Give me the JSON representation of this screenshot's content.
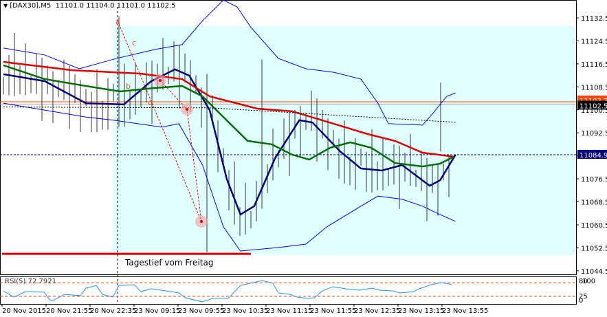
{
  "header": {
    "symbol": "[DAX30],M5",
    "ohlc": "11101.0 11104.0 11101.0 11102.5"
  },
  "colors": {
    "bg_zone": "#e0ffff",
    "ma_red": "#e00000",
    "ma_green": "#007000",
    "osc": "#00007f",
    "bands": "#0000ff",
    "rsi": "#1e90ff",
    "levels": "#ff4500"
  },
  "annotation": "Tagestief vom Freitag",
  "wave_labels": [
    "a",
    "b",
    "c",
    "d"
  ],
  "chart_data": {
    "type": "line",
    "title": "[DAX30],M5",
    "price_axis": {
      "ticks": [
        "11132.5",
        "11124.5",
        "11116.5",
        "11108.5",
        "11100.5",
        "11092.5",
        "11084.5",
        "11076.5",
        "11068.5",
        "11060.5",
        "11052.5",
        "11044.5"
      ],
      "range": [
        11044.5,
        11138
      ]
    },
    "price_labels": {
      "bid": "11102.5",
      "ask": "11103.3",
      "level": "11084.9"
    },
    "time_axis": [
      "20 Nov 2015",
      "20 Nov 21:55",
      "20 Nov 22:35",
      "23 Nov 09:15",
      "23 Nov 09:55",
      "23 Nov 10:35",
      "23 Nov 11:15",
      "23 Nov 11:55",
      "23 Nov 12:35",
      "23 Nov 13:15",
      "23 Nov 13:55"
    ],
    "series": [
      {
        "name": "oscillator-curve",
        "points": [
          [
            0,
            11112.9
          ],
          [
            7.5,
            11110.5
          ],
          [
            15,
            11102.8
          ],
          [
            21.9,
            11102.4
          ],
          [
            26.9,
            11110.5
          ],
          [
            31.2,
            11114.6
          ],
          [
            33.8,
            11112.4
          ],
          [
            37.5,
            11100.4
          ],
          [
            40.6,
            11076.5
          ],
          [
            43.1,
            11064.1
          ],
          [
            45.6,
            11067
          ],
          [
            49.4,
            11083.7
          ],
          [
            53.8,
            11096.9
          ],
          [
            56.2,
            11096.1
          ],
          [
            61.2,
            11086.1
          ],
          [
            65,
            11080.1
          ],
          [
            68.8,
            11079.4
          ],
          [
            72.5,
            11081.3
          ],
          [
            77.5,
            11074.1
          ],
          [
            79.4,
            11076
          ],
          [
            82.2,
            11084.9
          ]
        ]
      },
      {
        "name": "ma-red",
        "points": [
          [
            0,
            11117.2
          ],
          [
            12.5,
            11114.3
          ],
          [
            25,
            11113.1
          ],
          [
            32.5,
            11111.2
          ],
          [
            37.5,
            11105.2
          ],
          [
            46.2,
            11100.9
          ],
          [
            52.5,
            11100
          ],
          [
            60,
            11095.7
          ],
          [
            66.2,
            11092.1
          ],
          [
            71.2,
            11089.7
          ],
          [
            76.2,
            11085.6
          ],
          [
            81.9,
            11084.2
          ]
        ]
      },
      {
        "name": "ma-green",
        "points": [
          [
            0,
            11116
          ],
          [
            7.5,
            11111.2
          ],
          [
            15,
            11108.8
          ],
          [
            21.2,
            11106.9
          ],
          [
            27.5,
            11108.1
          ],
          [
            32.5,
            11108.8
          ],
          [
            36.2,
            11105.2
          ],
          [
            40,
            11098
          ],
          [
            44.4,
            11089.7
          ],
          [
            48.8,
            11088.5
          ],
          [
            52.5,
            11084.9
          ],
          [
            55.6,
            11083.2
          ],
          [
            59.4,
            11087.3
          ],
          [
            63.1,
            11089.2
          ],
          [
            66.9,
            11087.3
          ],
          [
            71.2,
            11082
          ],
          [
            76.2,
            11080.8
          ],
          [
            79.4,
            11081.8
          ],
          [
            81.9,
            11084.2
          ]
        ]
      },
      {
        "name": "band-upper",
        "points": [
          [
            0,
            11122
          ],
          [
            7.5,
            11119.6
          ],
          [
            13.8,
            11114.8
          ],
          [
            20.6,
            11118.4
          ],
          [
            27.5,
            11121.5
          ],
          [
            32.5,
            11123.2
          ],
          [
            36.2,
            11131.5
          ],
          [
            40,
            11138.7
          ],
          [
            42.5,
            11136.3
          ],
          [
            45,
            11129.2
          ],
          [
            50,
            11118.4
          ],
          [
            55,
            11114.8
          ],
          [
            60,
            11113.6
          ],
          [
            65,
            11111.2
          ],
          [
            68.1,
            11102.8
          ],
          [
            70,
            11095.7
          ],
          [
            76.2,
            11095.2
          ],
          [
            78.1,
            11099.3
          ],
          [
            80.6,
            11105.2
          ],
          [
            82.2,
            11106.4
          ]
        ]
      },
      {
        "name": "band-lower",
        "points": [
          [
            0,
            11102.8
          ],
          [
            7.5,
            11100.4
          ],
          [
            15,
            11098
          ],
          [
            20,
            11096.9
          ],
          [
            28.8,
            11094.5
          ],
          [
            31.9,
            11095.7
          ],
          [
            36.2,
            11081.3
          ],
          [
            40,
            11059.8
          ],
          [
            43.1,
            11051.4
          ],
          [
            50,
            11052.6
          ],
          [
            55,
            11053.8
          ],
          [
            58.8,
            11059.8
          ],
          [
            65,
            11067
          ],
          [
            68.1,
            11070.5
          ],
          [
            72.5,
            11069.4
          ],
          [
            76.2,
            11067
          ],
          [
            78.8,
            11064.6
          ],
          [
            82.2,
            11061.7
          ]
        ]
      },
      {
        "name": "dotted-trend",
        "points": [
          [
            0,
            11101.5
          ],
          [
            37.5,
            11101.2
          ],
          [
            82.2,
            11096.2
          ]
        ]
      }
    ],
    "bars": [
      [
        21,
        11133,
        11103
      ],
      [
        37,
        11101,
        11051
      ],
      [
        47,
        11118,
        11082
      ],
      [
        79.5,
        11110,
        11086
      ]
    ],
    "support_level": 11050.4,
    "rsi": {
      "label": "RSI(5) 72.7921",
      "levels": [
        80,
        25
      ],
      "level_labels": [
        "80",
        "100",
        "25",
        "0"
      ],
      "points": [
        [
          0,
          47
        ],
        [
          1.9,
          22
        ],
        [
          4,
          44
        ],
        [
          7.4,
          42
        ],
        [
          8.4,
          11
        ],
        [
          9,
          8
        ],
        [
          11.1,
          33
        ],
        [
          14,
          28
        ],
        [
          15,
          58
        ],
        [
          16.9,
          69
        ],
        [
          18,
          33
        ],
        [
          19.9,
          22
        ],
        [
          21,
          69
        ],
        [
          23.8,
          72
        ],
        [
          25,
          44
        ],
        [
          26.9,
          56
        ],
        [
          29.6,
          47
        ],
        [
          31.9,
          39
        ],
        [
          33.1,
          19
        ],
        [
          36.1,
          3
        ],
        [
          38.1,
          17
        ],
        [
          40.9,
          17
        ],
        [
          43.1,
          69
        ],
        [
          44.9,
          78
        ],
        [
          47.1,
          89
        ],
        [
          49,
          78
        ],
        [
          50,
          39
        ],
        [
          52.1,
          33
        ],
        [
          53.4,
          22
        ],
        [
          55.4,
          17
        ],
        [
          56.5,
          19
        ],
        [
          58,
          47
        ],
        [
          59.9,
          64
        ],
        [
          62.1,
          56
        ],
        [
          64.6,
          50
        ],
        [
          67.1,
          58
        ],
        [
          68.4,
          50
        ],
        [
          70.9,
          47
        ],
        [
          72.1,
          39
        ],
        [
          74.6,
          44
        ],
        [
          75.6,
          56
        ],
        [
          77.8,
          72
        ],
        [
          79.6,
          81
        ],
        [
          81.5,
          72.8
        ]
      ]
    }
  }
}
